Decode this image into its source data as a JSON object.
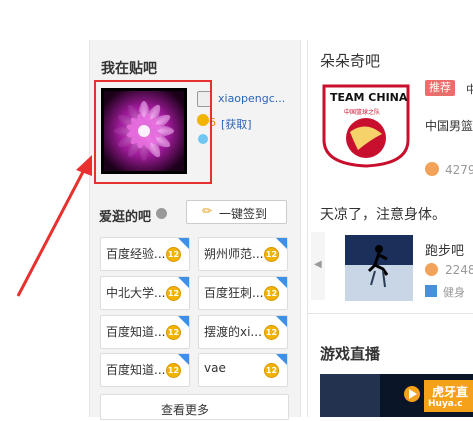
{
  "left": {
    "my_forums_title": "我在贴吧",
    "username": "xiaopengc...",
    "points_value": "6",
    "get_link": "[获取]",
    "liked_forums_title": "爱逛的吧",
    "checkin_button": "一键签到",
    "tiles": [
      {
        "name": "百度经验...",
        "level": "12"
      },
      {
        "name": "朔州师范...",
        "level": "12"
      },
      {
        "name": "中北大学...",
        "level": "12"
      },
      {
        "name": "百度狂刺...",
        "level": "12"
      },
      {
        "name": "百度知道...",
        "level": "12"
      },
      {
        "name": "摆渡的xi...",
        "level": "12"
      },
      {
        "name": "百度知道...",
        "level": "12"
      },
      {
        "name": "vae",
        "level": "12"
      }
    ],
    "see_more": "查看更多"
  },
  "right": {
    "forum_title": "朵朵奇吧",
    "recommend_badge": "推荐",
    "badge_trailing_char": "中",
    "team_logo_top": "TEAM CHINA",
    "team_logo_sub": "中国篮球之队",
    "forum_desc": "中国男篮",
    "member_count": "4279",
    "post_text": "天凉了，注意身体。",
    "run_forum_name": "跑步吧",
    "run_count": "2248",
    "run_tag": "健身",
    "live_title": "游戏直播",
    "huya_text": "虎牙直",
    "huya_domain": "Huya.c"
  },
  "colors": {
    "annotation_red": "#e8312f",
    "link_blue": "#2d64b3",
    "badge_red": "#f06b6b"
  }
}
